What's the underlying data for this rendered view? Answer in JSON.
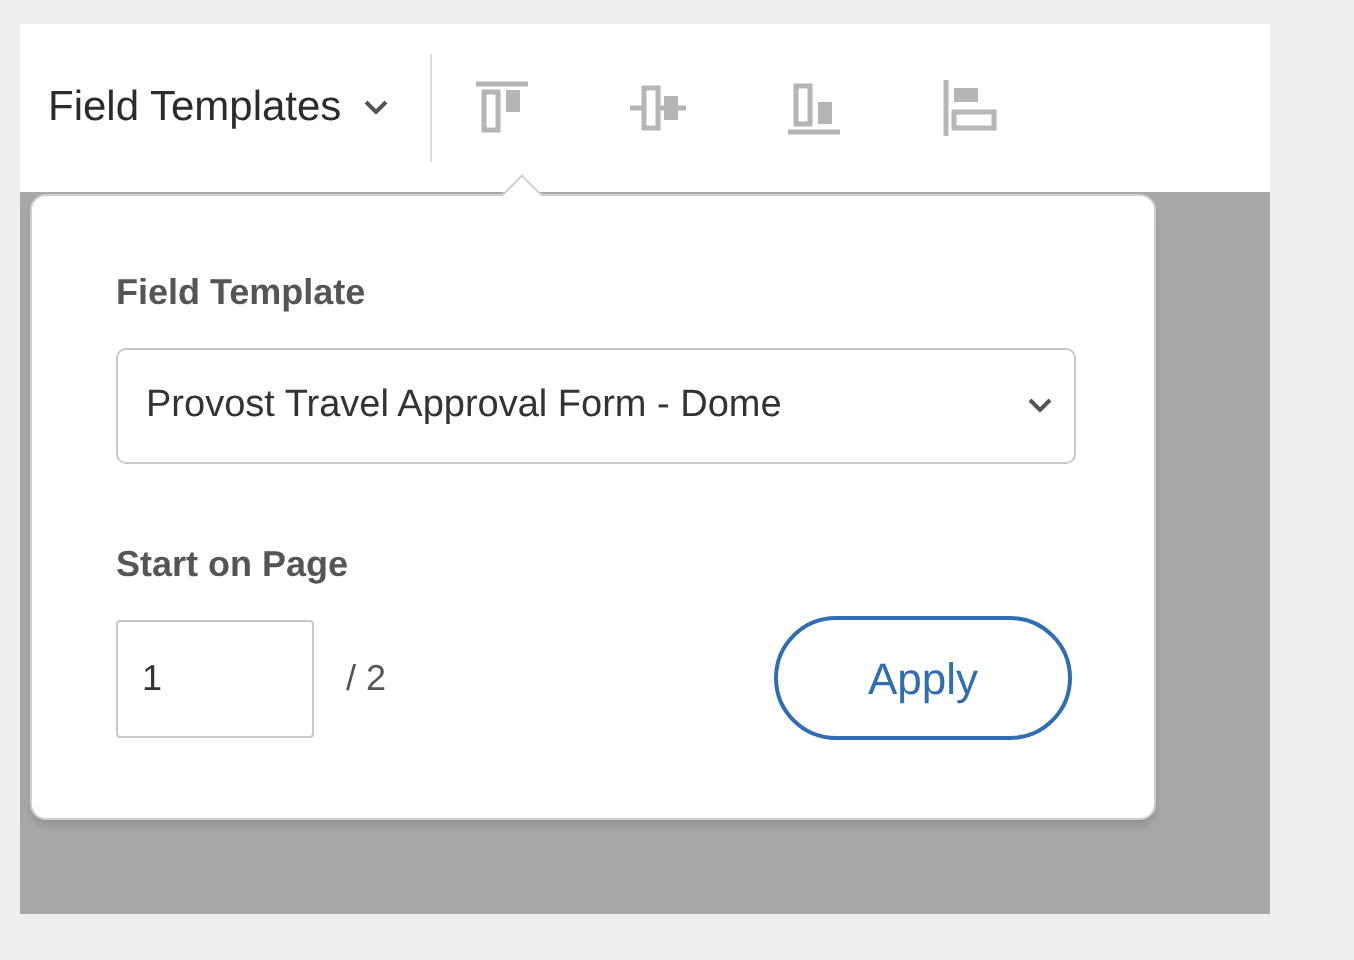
{
  "toolbar": {
    "menu_label": "Field Templates",
    "tools": [
      {
        "kind": "align-top"
      },
      {
        "kind": "align-middle"
      },
      {
        "kind": "align-bottom"
      },
      {
        "kind": "align-left"
      }
    ]
  },
  "popover": {
    "template_label": "Field Template",
    "template_value": "Provost Travel Approval Form - Dome",
    "start_label": "Start on Page",
    "page_value": "1",
    "page_total": "/ 2",
    "apply": "Apply"
  }
}
